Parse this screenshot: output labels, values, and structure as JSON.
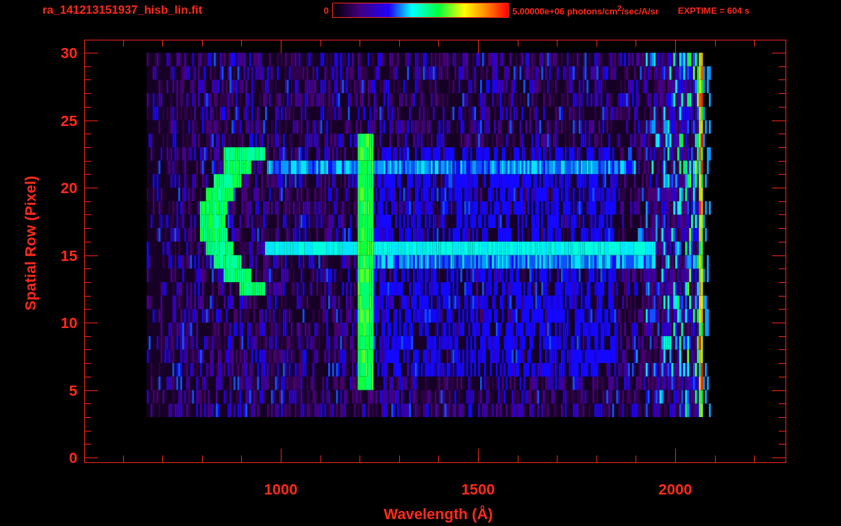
{
  "header": {
    "filename": "ra_141213151937_hisb_lin.fit",
    "colorbar_min": "0",
    "colorbar_max": "5.00000e+06 photons/cm$^{2}$/sec/A/sr",
    "exposure": "EXPTIME = 604 s"
  },
  "plot": {
    "y_title": "Spatial Row (Pixel)",
    "x_title": "Wavelength (Å)",
    "y_ticks": [
      "30",
      "25",
      "20",
      "15",
      "10",
      "5",
      "0"
    ],
    "x_ticks": [
      "1000",
      "1500",
      "2000"
    ]
  }
}
